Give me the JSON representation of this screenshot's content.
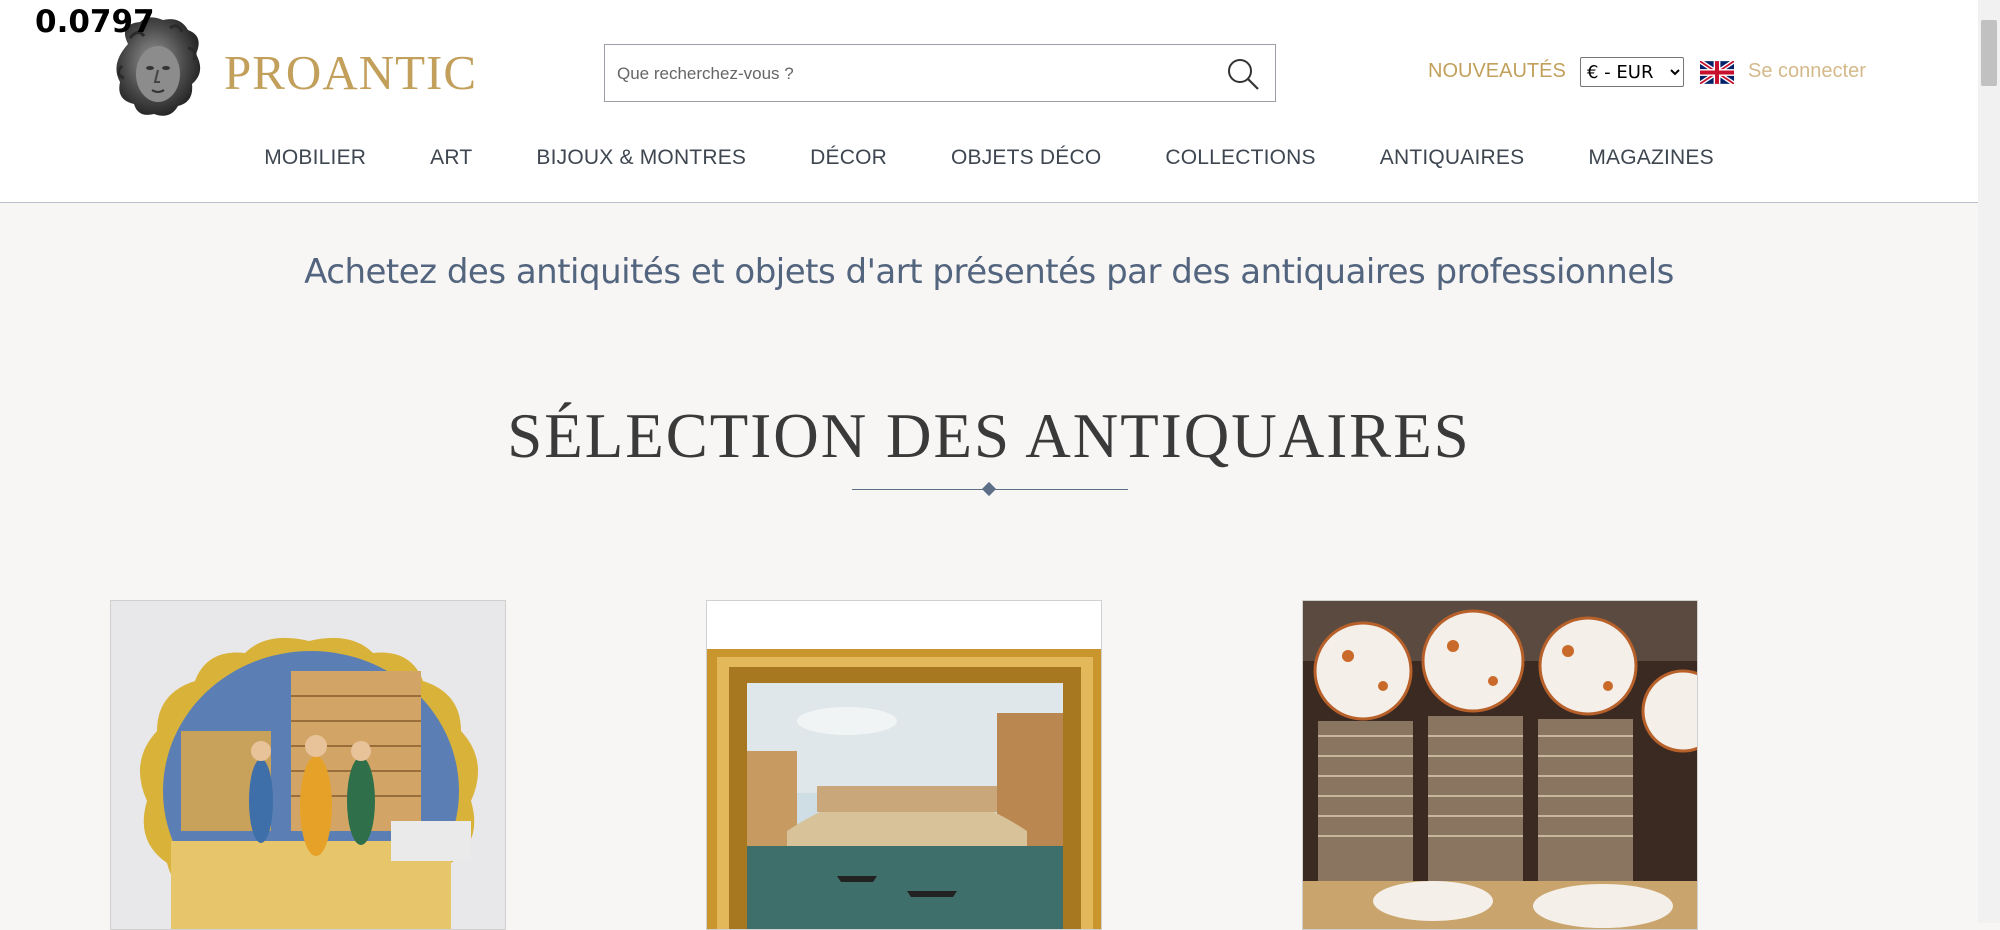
{
  "overlay_value": "0.0797",
  "header": {
    "logo_text": "PROANTIC",
    "search": {
      "placeholder": "Que recherchez-vous ?",
      "value": ""
    },
    "new_link": "NOUVEAUTÉS",
    "currency": {
      "selected": "€ - EUR",
      "options": [
        "€ - EUR"
      ]
    },
    "language_flag": "uk-flag-icon",
    "login_link": "Se connecter"
  },
  "nav": {
    "items": [
      {
        "label": "MOBILIER"
      },
      {
        "label": "ART"
      },
      {
        "label": "BIJOUX & MONTRES"
      },
      {
        "label": "DÉCOR"
      },
      {
        "label": "OBJETS DÉCO"
      },
      {
        "label": "COLLECTIONS"
      },
      {
        "label": "ANTIQUAIRES"
      },
      {
        "label": "MAGAZINES"
      }
    ]
  },
  "main": {
    "tagline": "Achetez des antiquités et objets d'art présentés par des antiquaires professionnels",
    "section_title": "SÉLECTION DES ANTIQUAIRES",
    "products": [
      {
        "image": "majolica-plate-image"
      },
      {
        "image": "venice-rialto-painting-image"
      },
      {
        "image": "porcelain-dinner-service-image"
      }
    ]
  },
  "colors": {
    "brand_gold": "#c2a05b",
    "nav_text": "#3e4650",
    "tagline_blue": "#53657e",
    "page_bg": "#f7f6f5"
  }
}
